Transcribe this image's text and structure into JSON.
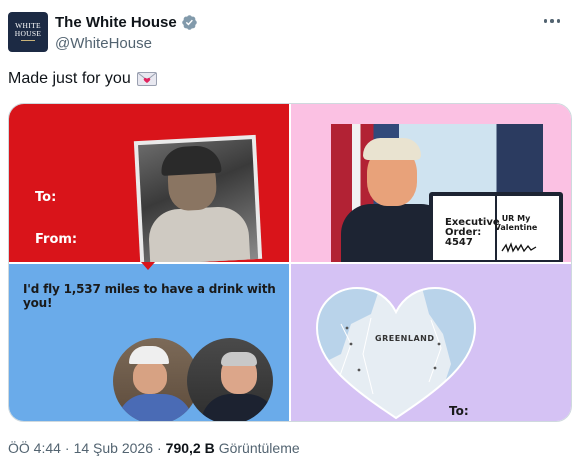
{
  "account": {
    "avatar_line1": "WHITE",
    "avatar_line2": "HOUSE",
    "name": "The White House",
    "handle": "@WhiteHouse",
    "verified_icon": "verified-badge-icon"
  },
  "tweet": {
    "text": "Made just for you",
    "emoji_icon": "love-letter-icon"
  },
  "cards": {
    "card1": {
      "to_label": "To:",
      "from_label": "From:",
      "bg": "#d9141a"
    },
    "card2": {
      "left_page": "Executive\nOrder:\n4547",
      "right_page": "UR My\nValentine",
      "bg": "#fbc1e3"
    },
    "card3": {
      "headline": "I'd fly 1,537 miles to have a drink with you!",
      "bg": "#6aabea"
    },
    "card4": {
      "map_label": "GREENLAND",
      "to_label": "To:",
      "bg": "#d5c2f4"
    }
  },
  "meta": {
    "time": "ÖÖ 4:44",
    "sep1": "·",
    "date": "14 Şub 2026",
    "sep2": "·",
    "views_count": "790,2 B",
    "views_label": "Görüntüleme"
  }
}
